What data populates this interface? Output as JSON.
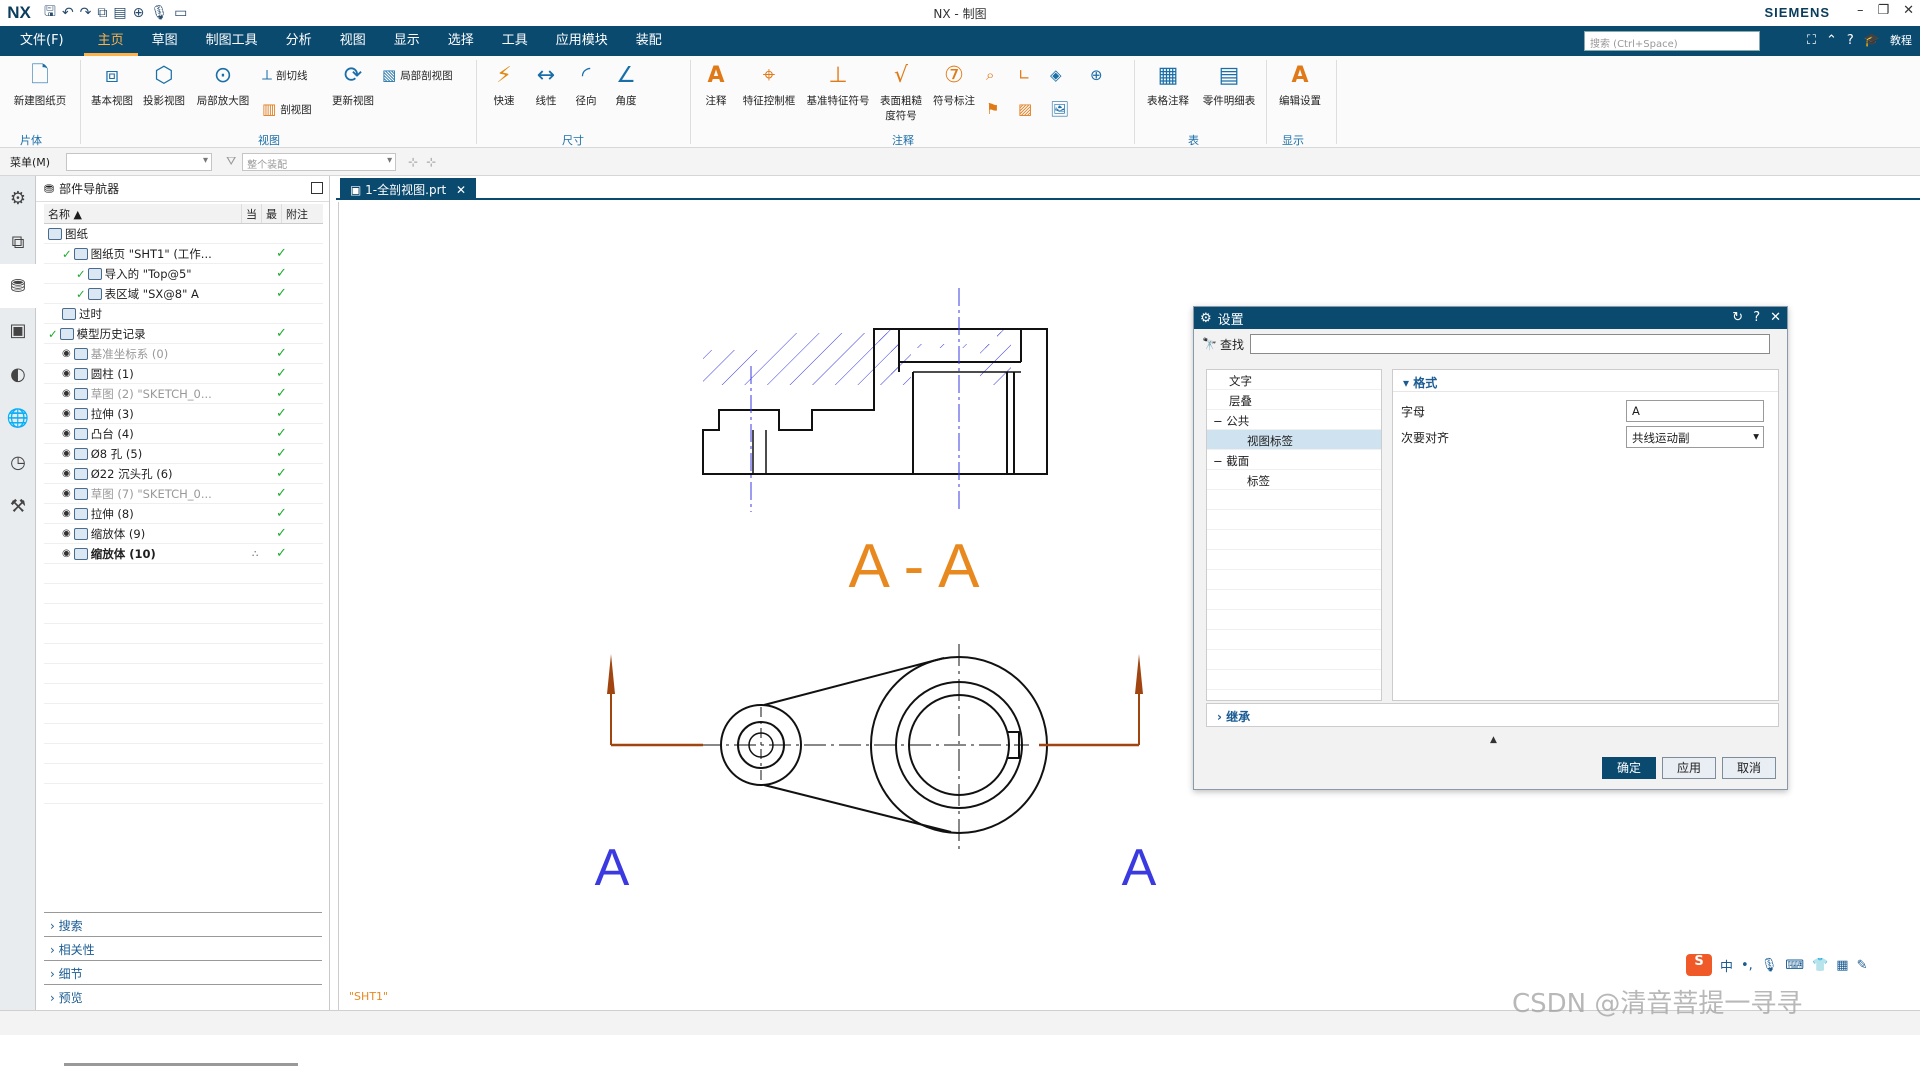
{
  "app": {
    "logo": "NX",
    "window_title": "NX - 制图",
    "brand": "SIEMENS"
  },
  "menubar": {
    "file": "文件(F)",
    "tabs": [
      "主页",
      "草图",
      "制图工具",
      "分析",
      "视图",
      "显示",
      "选择",
      "工具",
      "应用模块",
      "装配"
    ],
    "active_tab": "主页",
    "search_placeholder": "搜索 (Ctrl+Space)",
    "tutorial": "教程"
  },
  "ribbon": {
    "sheet_group": {
      "label": "片体",
      "new_sheet": "新建图纸页"
    },
    "view_group": {
      "label": "视图",
      "base_view": "基本视图",
      "projected_view": "投影视图",
      "detail_view": "局部放大图",
      "section_line": "剖切线",
      "section_view": "剖视图",
      "update_view": "更新视图",
      "break_out_section": "局部剖视图"
    },
    "dimension_group": {
      "label": "尺寸",
      "rapid": "快速",
      "linear": "线性",
      "radial": "径向",
      "angular": "角度"
    },
    "annotation_group": {
      "label": "注释",
      "note": "注释",
      "fcf": "特征控制框",
      "datum": "基准特征符号",
      "surface_finish_line1": "表面粗糙",
      "surface_finish_line2": "度符号",
      "id_symbol": "符号标注"
    },
    "table_group": {
      "label": "表",
      "tabular_note": "表格注释",
      "parts_list": "零件明细表"
    },
    "display_group": {
      "label": "显示",
      "edit_settings": "编辑设置"
    }
  },
  "toolbar2": {
    "menu": "菜单(M)",
    "filter_placeholder": "",
    "assembly_scope": "整个装配"
  },
  "navigator": {
    "title": "部件导航器",
    "columns": [
      "名称",
      "当",
      "最",
      "附注"
    ],
    "rows": [
      {
        "label": "图纸",
        "indent": 0,
        "icon": "drawing-icon",
        "check": false,
        "dim": false,
        "bold": false
      },
      {
        "label": "图纸页 \"SHT1\" (工作...",
        "indent": 1,
        "icon": "sheet-icon",
        "check": true,
        "dim": false,
        "bold": false
      },
      {
        "label": "导入的 \"Top@5\"",
        "indent": 2,
        "icon": "view-icon",
        "check": true,
        "dim": false,
        "bold": false
      },
      {
        "label": "表区域 \"SX@8\" A",
        "indent": 2,
        "icon": "section-view-icon",
        "check": true,
        "dim": false,
        "bold": false
      },
      {
        "label": "过时",
        "indent": 1,
        "icon": "folder-icon",
        "check": false,
        "dim": false,
        "bold": false
      },
      {
        "label": "模型历史记录",
        "indent": 0,
        "icon": "history-icon",
        "check": true,
        "dim": false,
        "bold": false
      },
      {
        "label": "基准坐标系 (0)",
        "indent": 1,
        "icon": "csys-icon",
        "check": true,
        "dim": true,
        "bold": false
      },
      {
        "label": "圆柱 (1)",
        "indent": 1,
        "icon": "cylinder-icon",
        "check": true,
        "dim": false,
        "bold": false
      },
      {
        "label": "草图 (2) \"SKETCH_0...",
        "indent": 1,
        "icon": "sketch-icon",
        "check": true,
        "dim": true,
        "bold": false
      },
      {
        "label": "拉伸 (3)",
        "indent": 1,
        "icon": "extrude-icon",
        "check": true,
        "dim": false,
        "bold": false
      },
      {
        "label": "凸台 (4)",
        "indent": 1,
        "icon": "boss-icon",
        "check": true,
        "dim": false,
        "bold": false
      },
      {
        "label": "Ø8 孔 (5)",
        "indent": 1,
        "icon": "hole-icon",
        "check": true,
        "dim": false,
        "bold": false
      },
      {
        "label": "Ø22 沉头孔 (6)",
        "indent": 1,
        "icon": "counterbore-icon",
        "check": true,
        "dim": false,
        "bold": false
      },
      {
        "label": "草图 (7) \"SKETCH_0...",
        "indent": 1,
        "icon": "sketch-icon",
        "check": true,
        "dim": true,
        "bold": false
      },
      {
        "label": "拉伸 (8)",
        "indent": 1,
        "icon": "extrude-icon",
        "check": true,
        "dim": false,
        "bold": false
      },
      {
        "label": "缩放体 (9)",
        "indent": 1,
        "icon": "scale-icon",
        "check": true,
        "dim": false,
        "bold": false
      },
      {
        "label": "缩放体 (10)",
        "indent": 1,
        "icon": "scale-icon",
        "check": true,
        "dim": false,
        "bold": true
      }
    ],
    "sections": [
      "搜索",
      "相关性",
      "细节",
      "预览"
    ]
  },
  "document": {
    "tab": "1-全剖视图.prt",
    "sheet_name": "\"SHT1\"",
    "section_label": "A - A",
    "cut_letter_left": "A",
    "cut_letter_right": "A"
  },
  "dialog": {
    "title": "设置",
    "find_label": "查找",
    "tree": [
      {
        "label": "文字",
        "level": 1,
        "selected": false
      },
      {
        "label": "层叠",
        "level": 1,
        "selected": false
      },
      {
        "label": "公共",
        "level": 0,
        "selected": false
      },
      {
        "label": "视图标签",
        "level": 2,
        "selected": true
      },
      {
        "label": "截面",
        "level": 0,
        "selected": false
      },
      {
        "label": "标签",
        "level": 2,
        "selected": false
      }
    ],
    "format_header": "格式",
    "letter_label": "字母",
    "letter_value": "A",
    "secondary_align_label": "次要对齐",
    "secondary_align_value": "共线运动副",
    "inherit": "继承",
    "ok": "确定",
    "apply": "应用",
    "cancel": "取消"
  },
  "ime": {
    "lang": "中"
  },
  "watermark": "CSDN @清音菩提一寻寻",
  "colors": {
    "accent": "#0b4a6f",
    "active_tab": "#ffb24a",
    "label_orange": "#e8891f",
    "centerline_blue": "#3a3ae0",
    "cut_arrow": "#a0450f",
    "check_green": "#1eaa2e"
  }
}
